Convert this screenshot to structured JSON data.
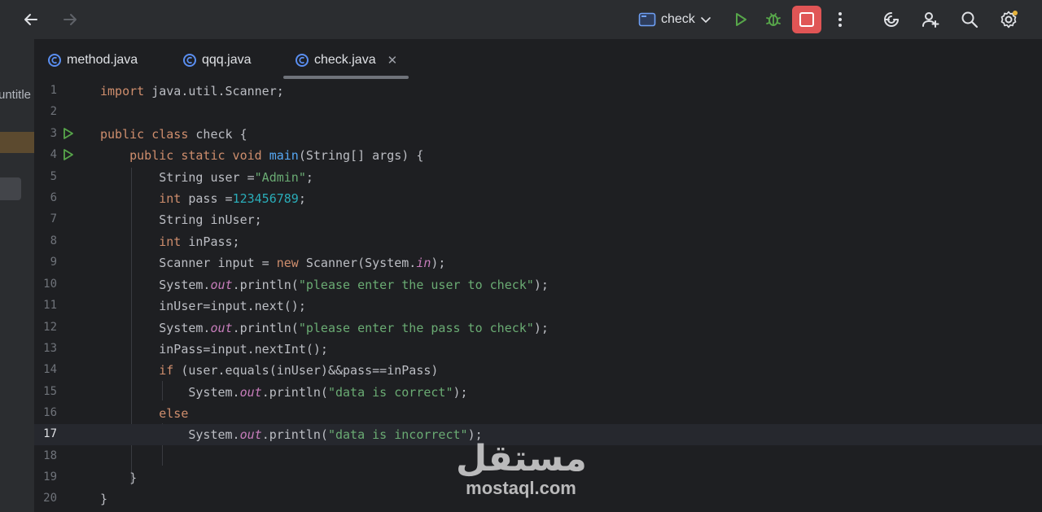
{
  "toolbar": {
    "run_config": "check",
    "icons": [
      "back-arrow-icon",
      "forward-arrow-icon",
      "run-config-icon",
      "chevron-down-icon",
      "run-icon",
      "debug-icon",
      "stop-icon",
      "more-icon",
      "ai-assistant-icon",
      "add-user-icon",
      "search-icon",
      "settings-icon"
    ]
  },
  "sidebar": {
    "project_label": "untitle"
  },
  "tabs": [
    {
      "label": "method.java"
    },
    {
      "label": "qqq.java"
    },
    {
      "label": "check.java"
    }
  ],
  "editor": {
    "current_line": 17,
    "line_numbers": [
      "1",
      "2",
      "3",
      "4",
      "5",
      "6",
      "7",
      "8",
      "9",
      "10",
      "11",
      "12",
      "13",
      "14",
      "15",
      "16",
      "17",
      "18",
      "19",
      "20"
    ]
  },
  "watermark": {
    "arabic": "مستقل",
    "latin": "mostaql.com"
  },
  "colors": {
    "keyword": "#cf8e6d",
    "string": "#6aab73",
    "number": "#2aacb8",
    "function": "#56a8f5",
    "static_field": "#c77dbb",
    "stop_button": "#e05555"
  }
}
